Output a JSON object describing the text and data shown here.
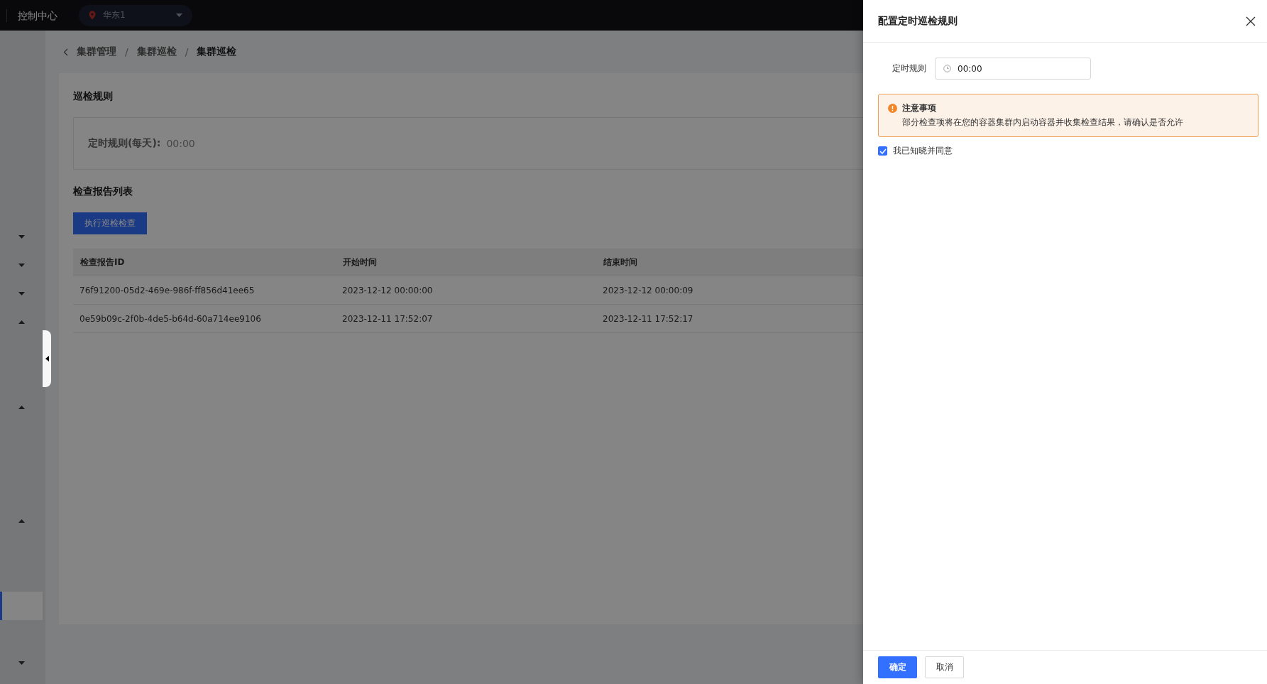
{
  "header": {
    "title": "控制中心",
    "region": "华东1"
  },
  "sidebar": {
    "items": [
      {
        "expanded": false
      },
      {
        "expanded": false
      },
      {
        "expanded": false
      },
      {
        "expanded": true,
        "children": [
          {
            "selected": false
          },
          {
            "selected": false
          }
        ]
      },
      {
        "expanded": true,
        "children": [
          {
            "selected": false
          },
          {
            "selected": false
          },
          {
            "selected": false
          }
        ]
      },
      {
        "expanded": true,
        "children": [
          {
            "selected": false
          },
          {
            "selected": false
          },
          {
            "selected": true
          },
          {
            "selected": false
          }
        ]
      },
      {
        "expanded": false
      }
    ]
  },
  "breadcrumb": {
    "separator": "/",
    "items": [
      "集群管理",
      "集群巡检",
      "集群巡检"
    ]
  },
  "rules_section": {
    "title": "巡检规则",
    "label": "定时规则(每天):",
    "value": "00:00"
  },
  "reports": {
    "title": "检查报告列表",
    "run_button": "执行巡检检查",
    "columns": [
      "检查报告ID",
      "开始时间",
      "结束时间"
    ],
    "rows": [
      [
        "76f91200-05d2-469e-986f-ff856d41ee65",
        "2023-12-12 00:00:00",
        "2023-12-12 00:00:09"
      ],
      [
        "0e59b09c-2f0b-4de5-b64d-60a714ee9106",
        "2023-12-11 17:52:07",
        "2023-12-11 17:52:17"
      ]
    ]
  },
  "drawer": {
    "title": "配置定时巡检规则",
    "field": {
      "label": "定时规则",
      "value": "00:00"
    },
    "alert": {
      "title": "注意事项",
      "message": "部分检查项将在您的容器集群内启动容器并收集检查结果，请确认是否允许"
    },
    "agreement": {
      "label": "我已知晓并同意",
      "checked": true
    },
    "buttons": [
      {
        "label": "确定",
        "kind": "primary"
      },
      {
        "label": "取消",
        "kind": "default"
      }
    ]
  }
}
